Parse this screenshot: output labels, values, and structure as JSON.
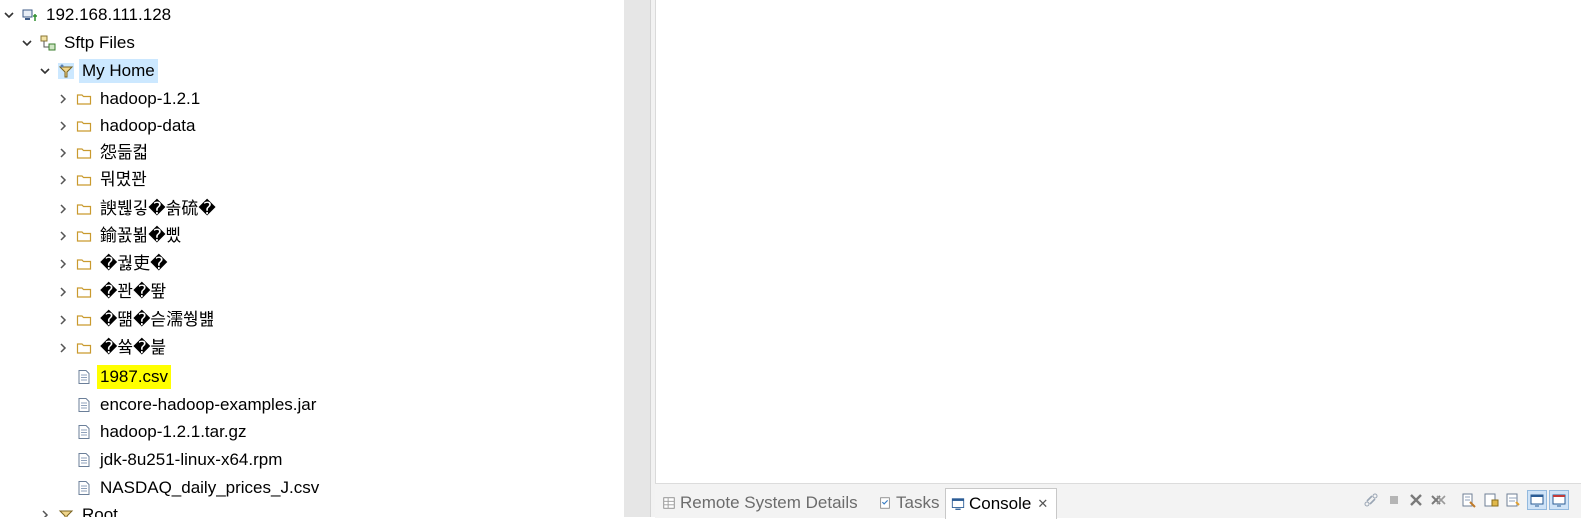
{
  "tree": {
    "connection": "192.168.111.128",
    "sftp_files": "Sftp Files",
    "my_home": "My Home",
    "folders": [
      "hadoop-1.2.1",
      "hadoop-data",
      "怨듦컯",
      "뭐몄꽌",
      "諛붾깋�솕硫�",
      "鍮꾨뵒�삤",
      "�궗吏�",
      "�꽌�뙆",
      "�떎�슫濡쒕뱶",
      "�쓬�븙"
    ],
    "files": [
      "1987.csv",
      "encore-hadoop-examples.jar",
      "hadoop-1.2.1.tar.gz",
      "jdk-8u251-linux-x64.rpm",
      "NASDAQ_daily_prices_J.csv"
    ],
    "root_partial": "Root"
  },
  "tabs": {
    "remote_system_details": "Remote System Details",
    "tasks": "Tasks",
    "console": "Console"
  },
  "colors": {
    "selection": "#cce8ff",
    "highlight": "#ffff00",
    "folder_stroke": "#c99a2e"
  }
}
